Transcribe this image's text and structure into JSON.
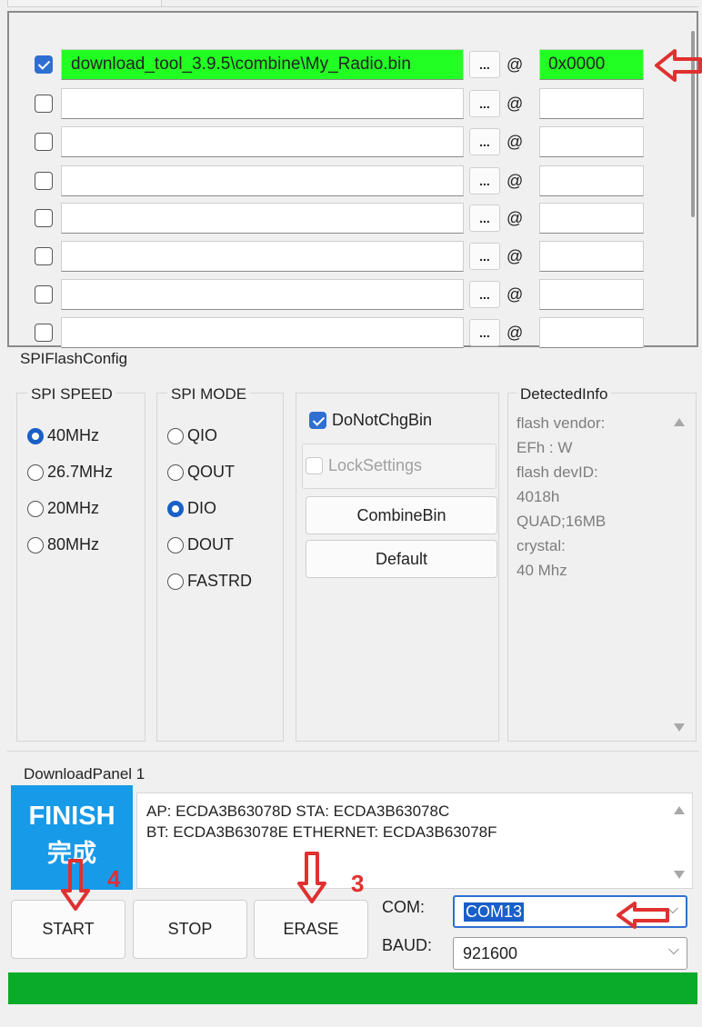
{
  "file_rows": [
    {
      "checked": true,
      "path": "download_tool_3.9.5\\combine\\My_Radio.bin",
      "dots": "...",
      "at": "@",
      "address": "0x0000",
      "highlight": true
    },
    {
      "checked": false,
      "path": "",
      "dots": "...",
      "at": "@",
      "address": "",
      "highlight": false
    },
    {
      "checked": false,
      "path": "",
      "dots": "...",
      "at": "@",
      "address": "",
      "highlight": false
    },
    {
      "checked": false,
      "path": "",
      "dots": "...",
      "at": "@",
      "address": "",
      "highlight": false
    },
    {
      "checked": false,
      "path": "",
      "dots": "...",
      "at": "@",
      "address": "",
      "highlight": false
    },
    {
      "checked": false,
      "path": "",
      "dots": "...",
      "at": "@",
      "address": "",
      "highlight": false
    },
    {
      "checked": false,
      "path": "",
      "dots": "...",
      "at": "@",
      "address": "",
      "highlight": false
    },
    {
      "checked": false,
      "path": "",
      "dots": "...",
      "at": "@",
      "address": "",
      "highlight": false
    }
  ],
  "spi_config": {
    "title": "SPIFlashConfig",
    "speed": {
      "label": "SPI SPEED",
      "options": [
        "40MHz",
        "26.7MHz",
        "20MHz",
        "80MHz"
      ],
      "selected": "40MHz"
    },
    "mode": {
      "label": "SPI MODE",
      "options": [
        "QIO",
        "QOUT",
        "DIO",
        "DOUT",
        "FASTRD"
      ],
      "selected": "DIO"
    },
    "do_not_chg_bin": {
      "label": "DoNotChgBin",
      "checked": true
    },
    "lock_settings": {
      "label": "LockSettings",
      "checked": false,
      "disabled": true
    },
    "combine_bin_label": "CombineBin",
    "default_label": "Default",
    "detected": {
      "label": "DetectedInfo",
      "lines": [
        "flash vendor:",
        "EFh : W",
        "flash devID:",
        "4018h",
        "QUAD;16MB",
        "crystal:",
        "40 Mhz"
      ]
    }
  },
  "download_panel": {
    "title": "DownloadPanel 1",
    "status_en": "FINISH",
    "status_cn": "完成",
    "log": [
      "AP:  ECDA3B63078D  STA:  ECDA3B63078C",
      "BT:  ECDA3B63078E  ETHERNET:  ECDA3B63078F"
    ],
    "start_label": "START",
    "stop_label": "STOP",
    "erase_label": "ERASE",
    "com_label": "COM:",
    "com_value": "COM13",
    "baud_label": "BAUD:",
    "baud_value": "921600",
    "progress": 1.0
  },
  "annotations": {
    "erase_step": "3",
    "start_step": "4"
  },
  "colors": {
    "highlight_green": "#22ff22",
    "finish_blue": "#179ae8",
    "progress_green": "#0aaa2a",
    "annotation_red": "#e03030"
  }
}
